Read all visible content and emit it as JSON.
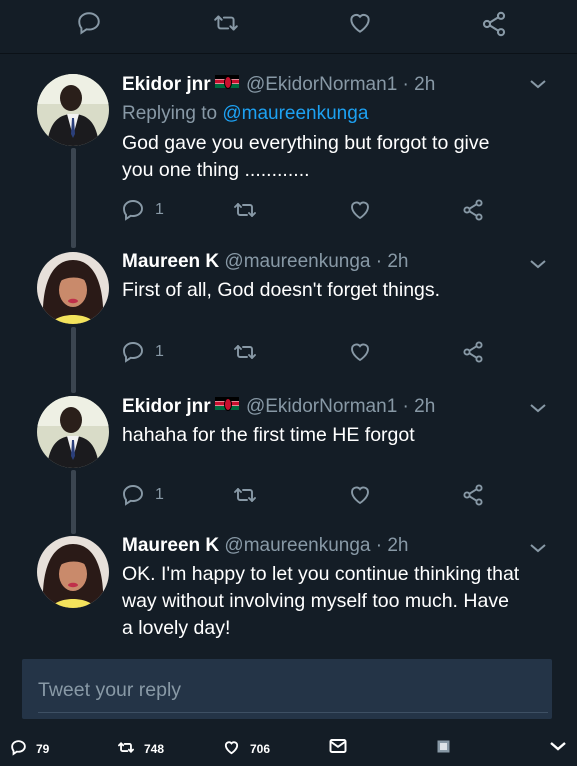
{
  "tweets": [
    {
      "name": "Ekidor jnr",
      "flag": "kenya-flag",
      "handle": "@EkidorNorman1",
      "dot": "·",
      "time": "2h",
      "replying_label": "Replying to",
      "replying_to": "@maureenkunga",
      "text_lines": [
        "God gave you everything but forgot to give",
        "you one thing ............"
      ],
      "reply_count": "1"
    },
    {
      "name": "Maureen K",
      "handle": "@maureenkunga",
      "dot": "·",
      "time": "2h",
      "text_lines": [
        "First of all, God doesn't forget things."
      ],
      "reply_count": "1"
    },
    {
      "name": "Ekidor jnr",
      "flag": "kenya-flag",
      "handle": "@EkidorNorman1",
      "dot": "·",
      "time": "2h",
      "text_lines": [
        "hahaha for the first time HE forgot"
      ],
      "reply_count": "1"
    },
    {
      "name": "Maureen K",
      "handle": "@maureenkunga",
      "dot": "·",
      "time": "2h",
      "text_lines": [
        "OK. I'm happy to let you continue thinking that",
        "way without involving myself too much. Have",
        "a lovely day!"
      ]
    }
  ],
  "reply_box": {
    "placeholder": "Tweet your reply"
  },
  "bottom_bar": {
    "replies": "79",
    "retweets": "748",
    "likes": "706"
  },
  "colors": {
    "background": "#141d26",
    "reply_box": "#243447",
    "muted": "#8899a6",
    "accent": "#1da1f2",
    "thread_line": "#3b4550"
  }
}
